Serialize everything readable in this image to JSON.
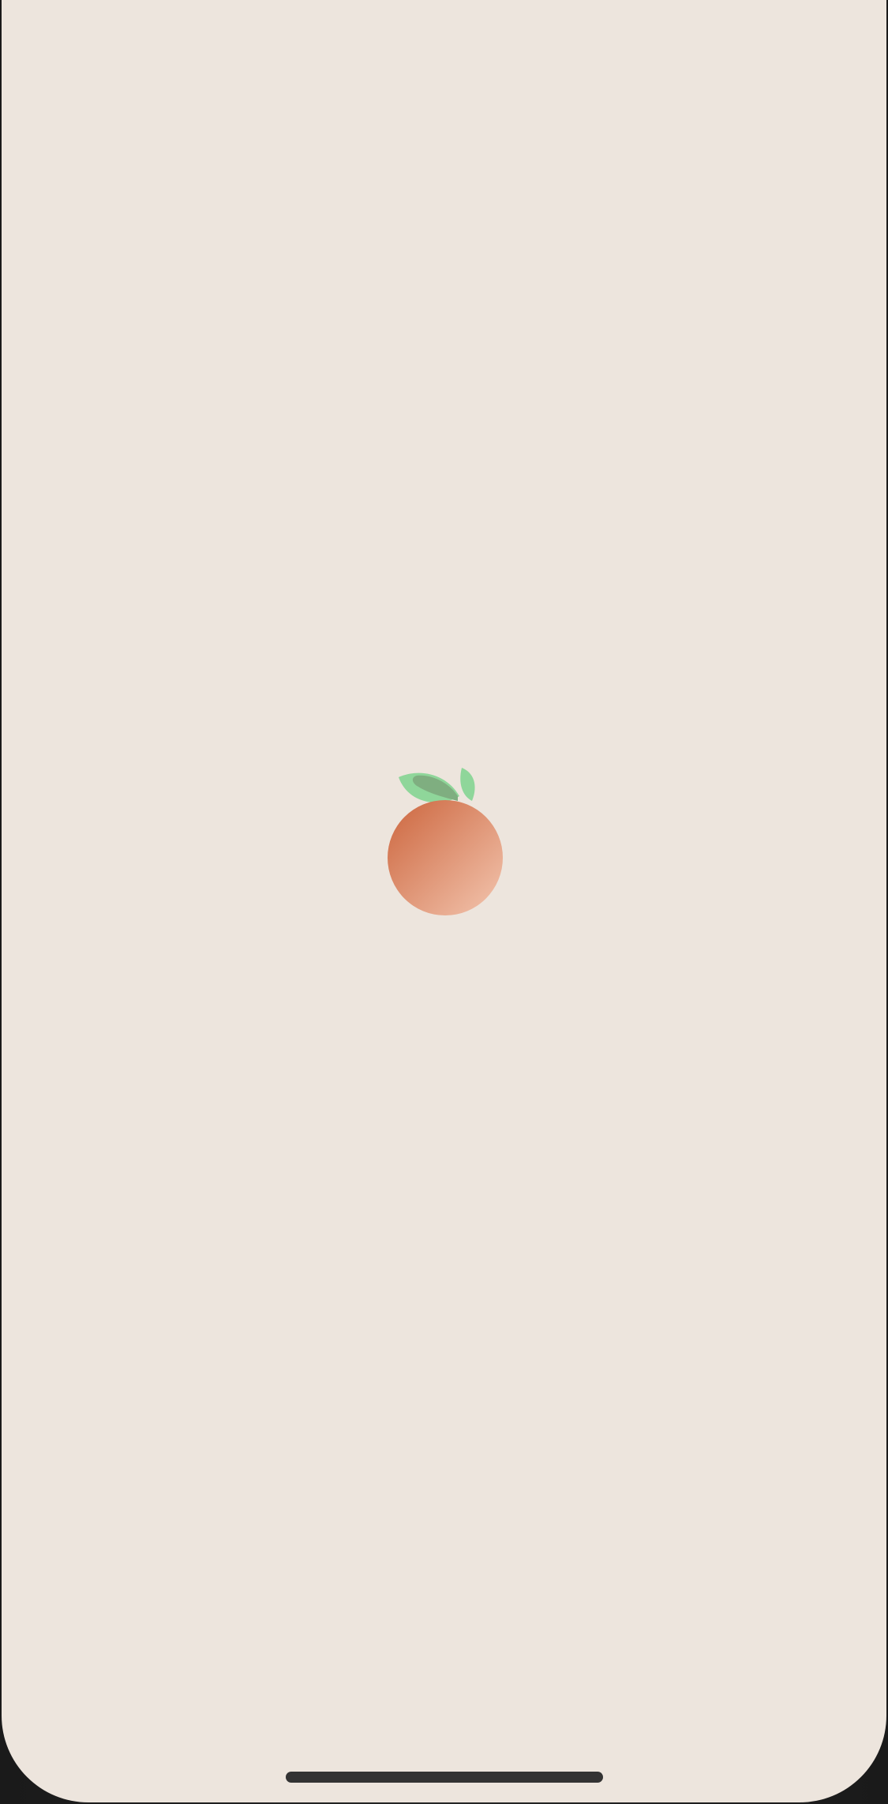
{
  "screen": {
    "background_color": "#ede5dd"
  },
  "logo": {
    "icon": "peach-icon",
    "fruit_color_start": "#d06f49",
    "fruit_color_end": "#efbca4",
    "leaf_color": "#8fd69a",
    "leaf_shadow_color": "#7fae80"
  },
  "home_indicator": {
    "color": "#333333"
  }
}
